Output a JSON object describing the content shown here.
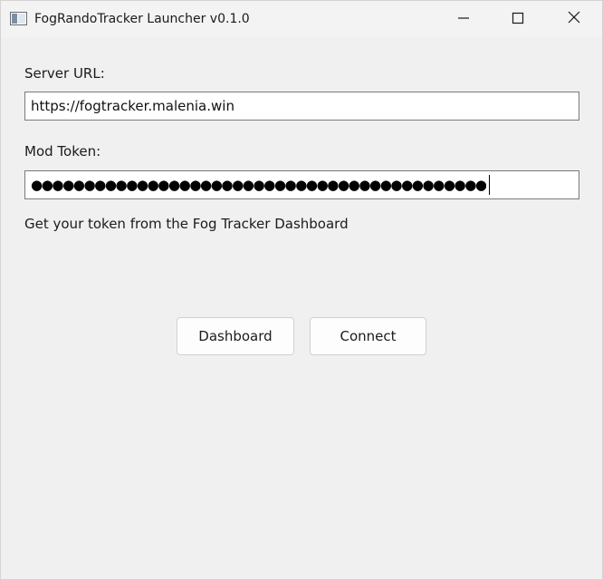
{
  "window": {
    "title": "FogRandoTracker Launcher v0.1.0",
    "controls": {
      "minimize": "minimize-icon",
      "maximize": "maximize-icon",
      "close": "close-icon"
    }
  },
  "form": {
    "server_url_label": "Server URL:",
    "server_url_value": "https://fogtracker.malenia.win",
    "mod_token_label": "Mod Token:",
    "mod_token_masked": "●●●●●●●●●●●●●●●●●●●●●●●●●●●●●●●●●●●●●●●●●●●",
    "hint": "Get your token from the Fog Tracker Dashboard"
  },
  "buttons": {
    "dashboard": "Dashboard",
    "connect": "Connect"
  },
  "colors": {
    "background": "#f0f0f0",
    "field_border": "#7a7a7a",
    "button_border": "#d0d0d0"
  }
}
